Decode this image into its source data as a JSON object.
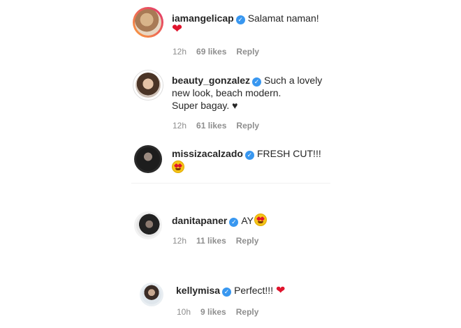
{
  "comments": [
    {
      "username": "iamangelicap",
      "text_lines": [
        "Salamat naman!"
      ],
      "emoji": "red-heart",
      "time": "12h",
      "likes": "69 likes",
      "reply": "Reply"
    },
    {
      "username": "beauty_gonzalez",
      "text_lines": [
        "Such a lovely",
        "new look, beach modern.",
        "Super bagay. ♥"
      ],
      "time": "12h",
      "likes": "61 likes",
      "reply": "Reply"
    },
    {
      "username": "missizacalzado",
      "text_lines": [
        "FRESH CUT!!!"
      ],
      "emoji": "heart-eyes-face",
      "time": "",
      "likes": "",
      "reply": ""
    },
    {
      "username": "danitapaner",
      "text_lines": [
        "AY"
      ],
      "emoji": "heart-eyes-face",
      "time": "12h",
      "likes": "11 likes",
      "reply": "Reply"
    },
    {
      "username": "kellymisa",
      "text_lines": [
        "Perfect!!!"
      ],
      "emoji": "red-heart",
      "time": "10h",
      "likes": "9 likes",
      "reply": "Reply"
    }
  ],
  "verified_icon": "verified-check-icon",
  "colors": {
    "verified": "#3897f0",
    "meta": "#8e8e8e",
    "heart": "#e0142d"
  }
}
